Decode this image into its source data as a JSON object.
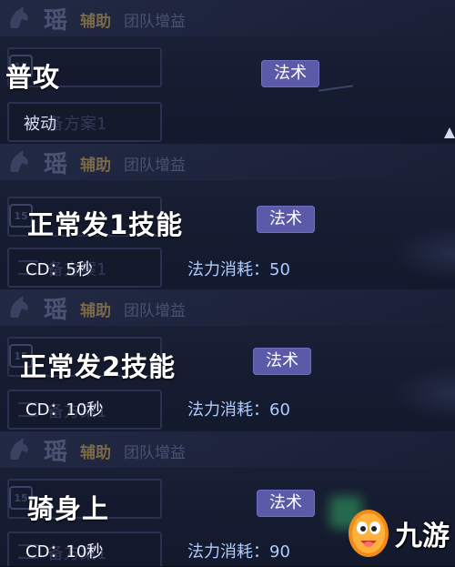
{
  "hero": {
    "name": "瑶",
    "role": "辅助",
    "tag": "团队增益",
    "emblem": "horse-head-icon"
  },
  "faded_plan": "备方案1",
  "faded_level": "15",
  "panels": [
    {
      "skill": "普攻",
      "badge": "法术",
      "sub": "被动"
    },
    {
      "skill": "正常发1技能",
      "badge": "法术",
      "cd": "CD：5秒",
      "mana": "法力消耗：50"
    },
    {
      "skill": "正常发2技能",
      "badge": "法术",
      "cd": "CD：10秒",
      "mana": "法力消耗：60"
    },
    {
      "skill": "骑身上",
      "badge": "法术",
      "cd": "CD：10秒",
      "mana": "法力消耗：90"
    }
  ],
  "watermark": {
    "text": "九游",
    "mascot": "nine-game-mascot-icon"
  },
  "colors": {
    "badge": "#5b5aa8",
    "role": "#7d6a45",
    "mana": "#aecbff"
  }
}
